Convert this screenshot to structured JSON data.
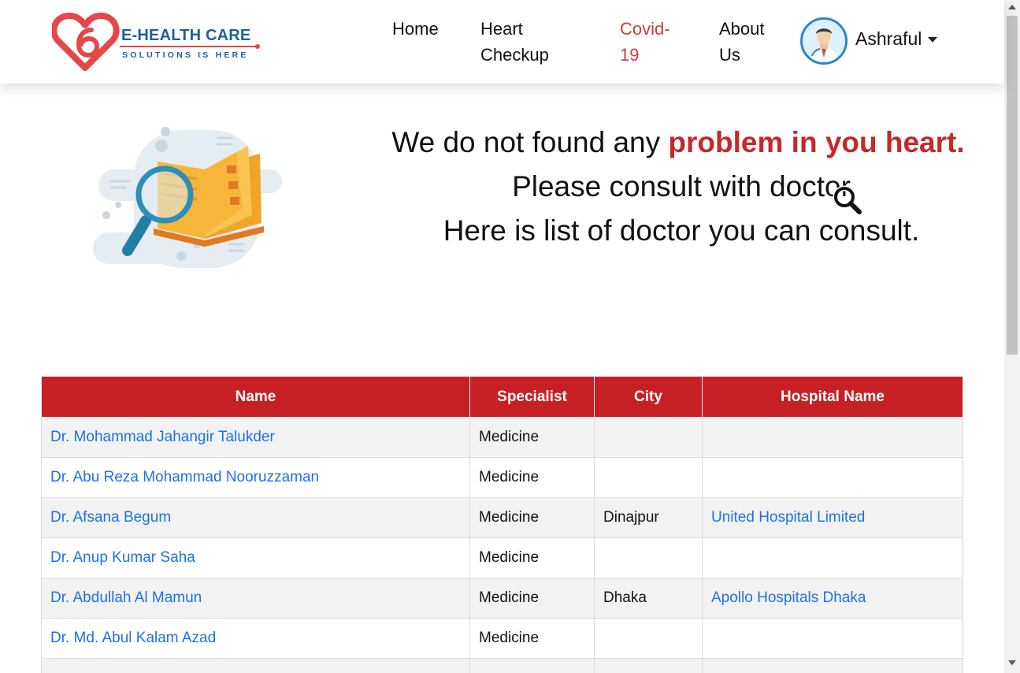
{
  "brand": {
    "name": "E-HEALTH CARE",
    "tagline": "SOLUTIONS IS HERE",
    "colors": {
      "heart": "#e5474b",
      "text": "#1f5fa0"
    }
  },
  "nav": {
    "items": [
      {
        "label_line1": "Home",
        "label_line2": ""
      },
      {
        "label_line1": "Heart",
        "label_line2": "Checkup"
      },
      {
        "label_line1": "Covid-",
        "label_line2": "19"
      },
      {
        "label_line1": "About",
        "label_line2": "Us"
      }
    ],
    "active_color": "#d33a3a",
    "user": {
      "name": "Ashraful",
      "avatar_icon": "doctor-avatar-icon"
    }
  },
  "hero": {
    "line1_prefix": "We do not found any ",
    "line1_highlight": "problem in you heart.",
    "line2": "Please consult with doctor",
    "line3": "Here is list of doctor you can consult.",
    "highlight_color": "#c62828",
    "illustration_icon": "magnifier-book-icon"
  },
  "table": {
    "header_color": "#c62026",
    "link_color": "#1a73e8",
    "columns": [
      "Name",
      "Specialist",
      "City",
      "Hospital Name"
    ],
    "rows": [
      {
        "name": "Dr. Mohammad Jahangir Talukder",
        "specialist": "Medicine",
        "city": "",
        "hospital": ""
      },
      {
        "name": "Dr. Abu Reza Mohammad Nooruzzaman",
        "specialist": "Medicine",
        "city": "",
        "hospital": ""
      },
      {
        "name": "Dr. Afsana Begum",
        "specialist": "Medicine",
        "city": "Dinajpur",
        "hospital": "United Hospital Limited"
      },
      {
        "name": "Dr. Anup Kumar Saha",
        "specialist": "Medicine",
        "city": "",
        "hospital": ""
      },
      {
        "name": "Dr. Abdullah Al Mamun",
        "specialist": "Medicine",
        "city": "Dhaka",
        "hospital": "Apollo Hospitals Dhaka"
      },
      {
        "name": "Dr. Md. Abul Kalam Azad",
        "specialist": "Medicine",
        "city": "",
        "hospital": ""
      },
      {
        "name": "",
        "specialist": "",
        "city": "",
        "hospital": ""
      }
    ]
  }
}
